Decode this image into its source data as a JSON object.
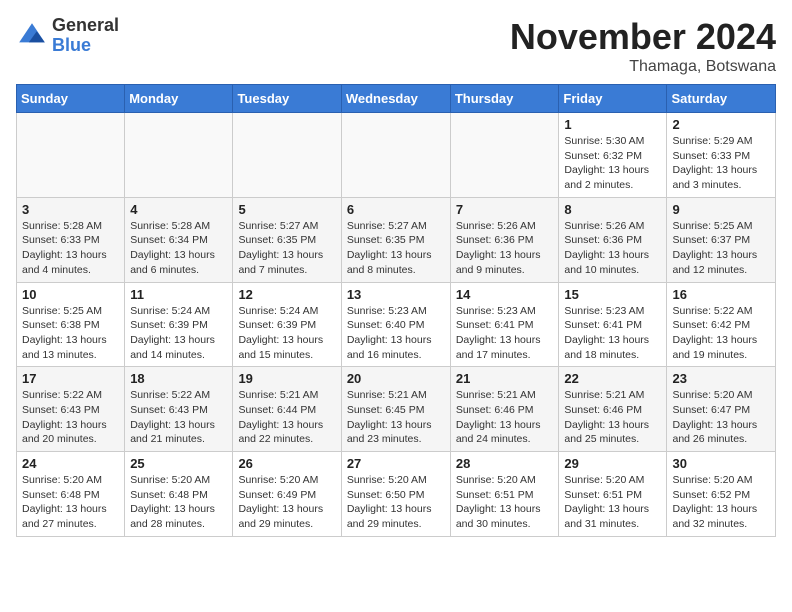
{
  "logo": {
    "general": "General",
    "blue": "Blue"
  },
  "header": {
    "month": "November 2024",
    "location": "Thamaga, Botswana"
  },
  "weekdays": [
    "Sunday",
    "Monday",
    "Tuesday",
    "Wednesday",
    "Thursday",
    "Friday",
    "Saturday"
  ],
  "weeks": [
    [
      {
        "day": "",
        "info": ""
      },
      {
        "day": "",
        "info": ""
      },
      {
        "day": "",
        "info": ""
      },
      {
        "day": "",
        "info": ""
      },
      {
        "day": "",
        "info": ""
      },
      {
        "day": "1",
        "info": "Sunrise: 5:30 AM\nSunset: 6:32 PM\nDaylight: 13 hours and 2 minutes."
      },
      {
        "day": "2",
        "info": "Sunrise: 5:29 AM\nSunset: 6:33 PM\nDaylight: 13 hours and 3 minutes."
      }
    ],
    [
      {
        "day": "3",
        "info": "Sunrise: 5:28 AM\nSunset: 6:33 PM\nDaylight: 13 hours and 4 minutes."
      },
      {
        "day": "4",
        "info": "Sunrise: 5:28 AM\nSunset: 6:34 PM\nDaylight: 13 hours and 6 minutes."
      },
      {
        "day": "5",
        "info": "Sunrise: 5:27 AM\nSunset: 6:35 PM\nDaylight: 13 hours and 7 minutes."
      },
      {
        "day": "6",
        "info": "Sunrise: 5:27 AM\nSunset: 6:35 PM\nDaylight: 13 hours and 8 minutes."
      },
      {
        "day": "7",
        "info": "Sunrise: 5:26 AM\nSunset: 6:36 PM\nDaylight: 13 hours and 9 minutes."
      },
      {
        "day": "8",
        "info": "Sunrise: 5:26 AM\nSunset: 6:36 PM\nDaylight: 13 hours and 10 minutes."
      },
      {
        "day": "9",
        "info": "Sunrise: 5:25 AM\nSunset: 6:37 PM\nDaylight: 13 hours and 12 minutes."
      }
    ],
    [
      {
        "day": "10",
        "info": "Sunrise: 5:25 AM\nSunset: 6:38 PM\nDaylight: 13 hours and 13 minutes."
      },
      {
        "day": "11",
        "info": "Sunrise: 5:24 AM\nSunset: 6:39 PM\nDaylight: 13 hours and 14 minutes."
      },
      {
        "day": "12",
        "info": "Sunrise: 5:24 AM\nSunset: 6:39 PM\nDaylight: 13 hours and 15 minutes."
      },
      {
        "day": "13",
        "info": "Sunrise: 5:23 AM\nSunset: 6:40 PM\nDaylight: 13 hours and 16 minutes."
      },
      {
        "day": "14",
        "info": "Sunrise: 5:23 AM\nSunset: 6:41 PM\nDaylight: 13 hours and 17 minutes."
      },
      {
        "day": "15",
        "info": "Sunrise: 5:23 AM\nSunset: 6:41 PM\nDaylight: 13 hours and 18 minutes."
      },
      {
        "day": "16",
        "info": "Sunrise: 5:22 AM\nSunset: 6:42 PM\nDaylight: 13 hours and 19 minutes."
      }
    ],
    [
      {
        "day": "17",
        "info": "Sunrise: 5:22 AM\nSunset: 6:43 PM\nDaylight: 13 hours and 20 minutes."
      },
      {
        "day": "18",
        "info": "Sunrise: 5:22 AM\nSunset: 6:43 PM\nDaylight: 13 hours and 21 minutes."
      },
      {
        "day": "19",
        "info": "Sunrise: 5:21 AM\nSunset: 6:44 PM\nDaylight: 13 hours and 22 minutes."
      },
      {
        "day": "20",
        "info": "Sunrise: 5:21 AM\nSunset: 6:45 PM\nDaylight: 13 hours and 23 minutes."
      },
      {
        "day": "21",
        "info": "Sunrise: 5:21 AM\nSunset: 6:46 PM\nDaylight: 13 hours and 24 minutes."
      },
      {
        "day": "22",
        "info": "Sunrise: 5:21 AM\nSunset: 6:46 PM\nDaylight: 13 hours and 25 minutes."
      },
      {
        "day": "23",
        "info": "Sunrise: 5:20 AM\nSunset: 6:47 PM\nDaylight: 13 hours and 26 minutes."
      }
    ],
    [
      {
        "day": "24",
        "info": "Sunrise: 5:20 AM\nSunset: 6:48 PM\nDaylight: 13 hours and 27 minutes."
      },
      {
        "day": "25",
        "info": "Sunrise: 5:20 AM\nSunset: 6:48 PM\nDaylight: 13 hours and 28 minutes."
      },
      {
        "day": "26",
        "info": "Sunrise: 5:20 AM\nSunset: 6:49 PM\nDaylight: 13 hours and 29 minutes."
      },
      {
        "day": "27",
        "info": "Sunrise: 5:20 AM\nSunset: 6:50 PM\nDaylight: 13 hours and 29 minutes."
      },
      {
        "day": "28",
        "info": "Sunrise: 5:20 AM\nSunset: 6:51 PM\nDaylight: 13 hours and 30 minutes."
      },
      {
        "day": "29",
        "info": "Sunrise: 5:20 AM\nSunset: 6:51 PM\nDaylight: 13 hours and 31 minutes."
      },
      {
        "day": "30",
        "info": "Sunrise: 5:20 AM\nSunset: 6:52 PM\nDaylight: 13 hours and 32 minutes."
      }
    ]
  ]
}
